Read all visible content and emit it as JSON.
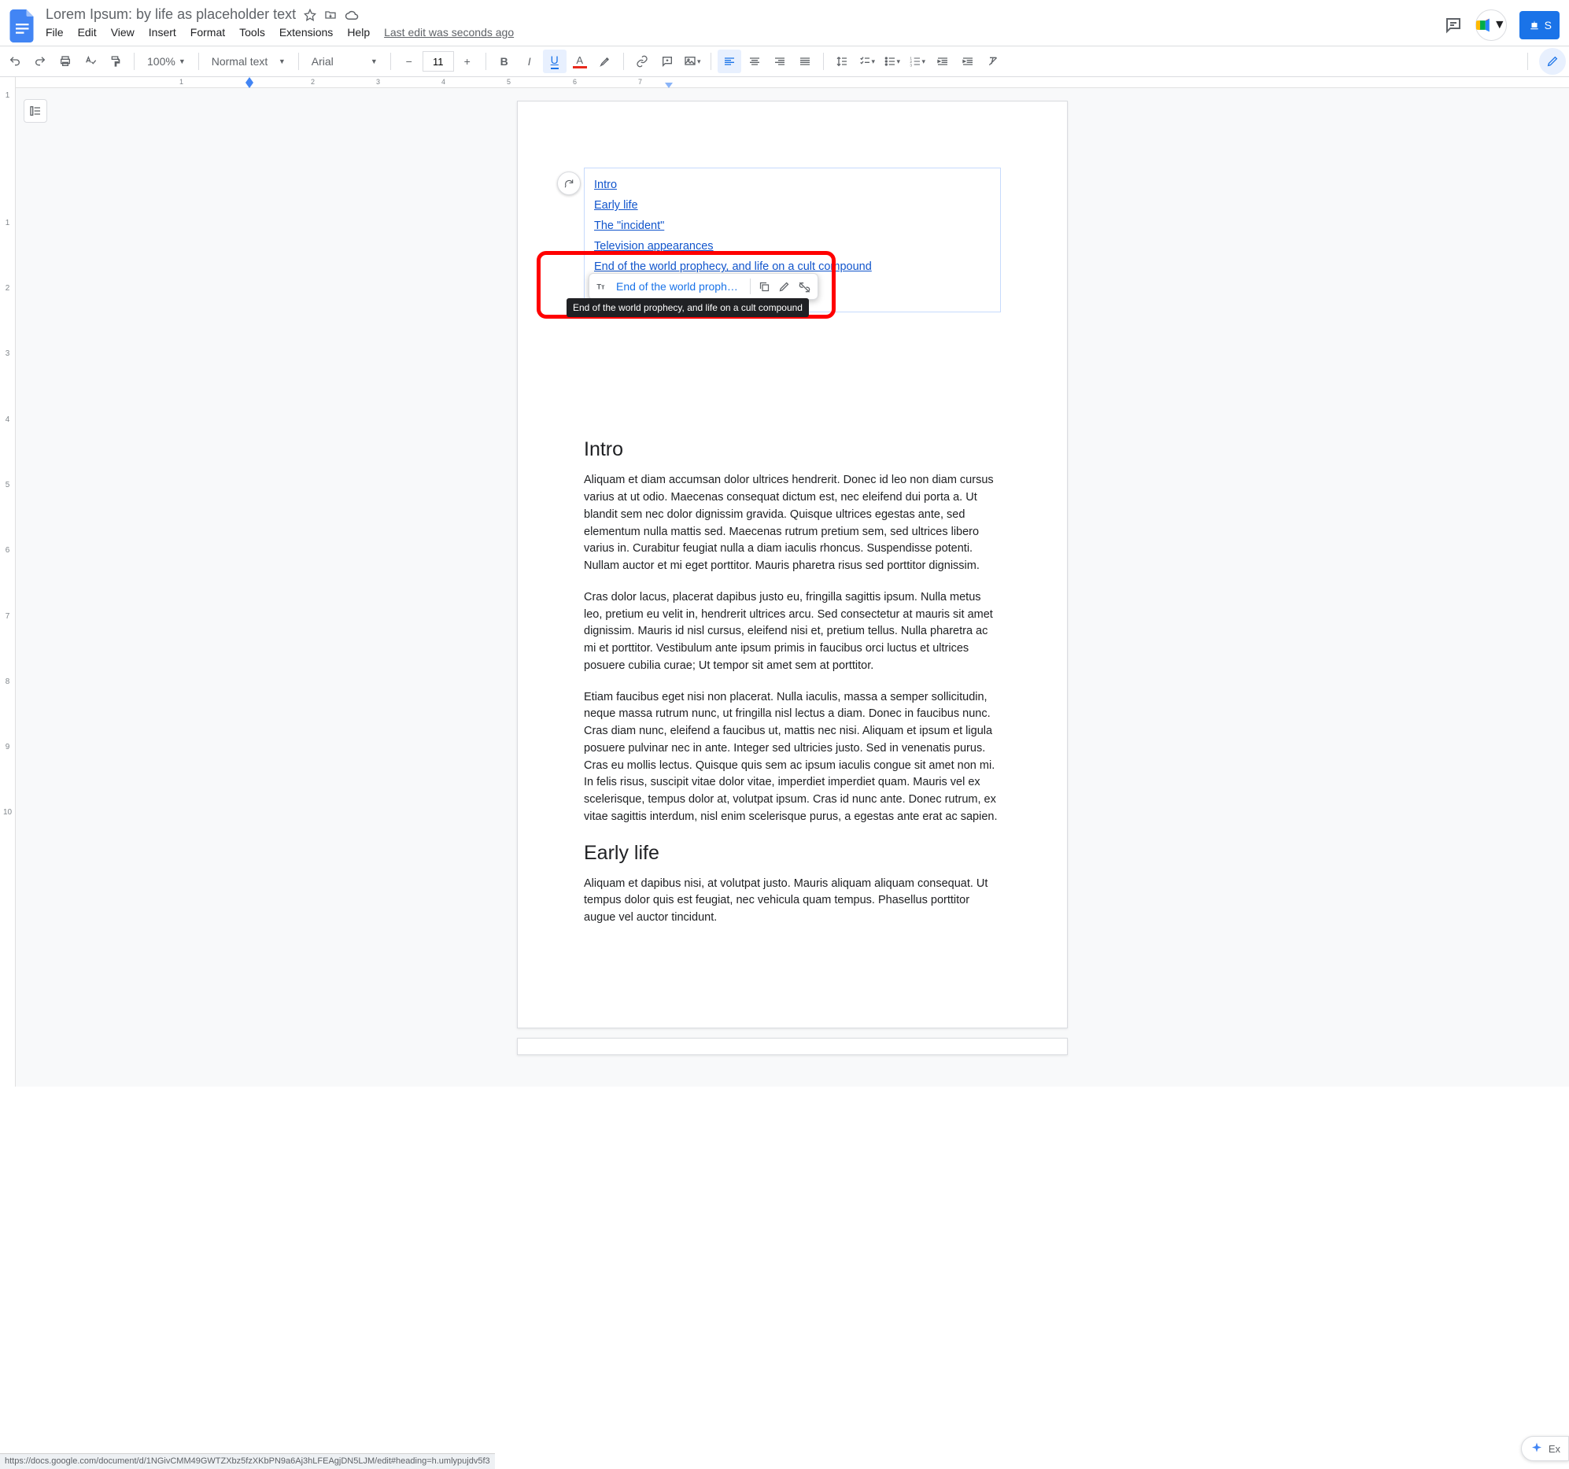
{
  "header": {
    "title": "Lorem Ipsum: by life as placeholder text",
    "menus": [
      "File",
      "Edit",
      "View",
      "Insert",
      "Format",
      "Tools",
      "Extensions",
      "Help"
    ],
    "last_edit": "Last edit was seconds ago",
    "share_label": "S"
  },
  "toolbar": {
    "zoom": "100%",
    "style": "Normal text",
    "font": "Arial",
    "font_size": "11"
  },
  "ruler": {
    "h": [
      "1",
      "2",
      "3",
      "4",
      "5",
      "6",
      "7"
    ],
    "v": [
      "1",
      "",
      "1",
      "2",
      "3",
      "4",
      "5",
      "6",
      "7",
      "8",
      "9",
      "10"
    ]
  },
  "toc": {
    "items": [
      "Intro",
      "Early life",
      "The \"incident\"",
      "Television appearances",
      "End of the world prophecy, and life on a cult compound"
    ]
  },
  "popup": {
    "link_text": "End of the world prophec...",
    "tooltip": "End of the world prophecy, and life on a cult compound"
  },
  "doc": {
    "h1_intro": "Intro",
    "p1": "Aliquam et diam accumsan dolor ultrices hendrerit. Donec id leo non diam cursus varius at ut odio. Maecenas consequat dictum est, nec eleifend dui porta a. Ut blandit sem nec dolor dignissim gravida. Quisque ultrices egestas ante, sed elementum nulla mattis sed. Maecenas rutrum pretium sem, sed ultrices libero varius in. Curabitur feugiat nulla a diam iaculis rhoncus. Suspendisse potenti. Nullam auctor et mi eget porttitor. Mauris pharetra risus sed porttitor dignissim.",
    "p2": "Cras dolor lacus, placerat dapibus justo eu, fringilla sagittis ipsum. Nulla metus leo, pretium eu velit in, hendrerit ultrices arcu. Sed consectetur at mauris sit amet dignissim. Mauris id nisl cursus, eleifend nisi et, pretium tellus. Nulla pharetra ac mi et porttitor. Vestibulum ante ipsum primis in faucibus orci luctus et ultrices posuere cubilia curae; Ut tempor sit amet sem at porttitor.",
    "p3": "Etiam faucibus eget nisi non placerat. Nulla iaculis, massa a semper sollicitudin, neque massa rutrum nunc, ut fringilla nisl lectus a diam. Donec in faucibus nunc. Cras diam nunc, eleifend a faucibus ut, mattis nec nisi. Aliquam et ipsum et ligula posuere pulvinar nec in ante. Integer sed ultricies justo. Sed in venenatis purus. Cras eu mollis lectus. Quisque quis sem ac ipsum iaculis congue sit amet non mi. In felis risus, suscipit vitae dolor vitae, imperdiet imperdiet quam. Mauris vel ex scelerisque, tempus dolor at, volutpat ipsum. Cras id nunc ante. Donec rutrum, ex vitae sagittis interdum, nisl enim scelerisque purus, a egestas ante erat ac sapien.",
    "h1_early": "Early life",
    "p4": "Aliquam et dapibus nisi, at volutpat justo. Mauris aliquam aliquam consequat. Ut tempus dolor quis est feugiat, nec vehicula quam tempus. Phasellus porttitor augue vel auctor tincidunt."
  },
  "footer": {
    "status_url": "https://docs.google.com/document/d/1NGivCMM49GWTZXbz5fzXKbPN9a6Aj3hLFEAgjDN5LJM/edit#heading=h.umlypujdv5f3",
    "explore_label": "Ex"
  }
}
